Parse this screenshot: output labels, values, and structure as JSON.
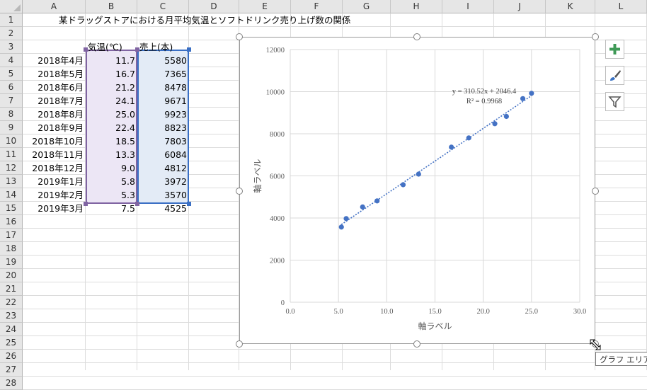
{
  "columns": [
    "A",
    "B",
    "C",
    "D",
    "E",
    "F",
    "G",
    "H",
    "I",
    "J",
    "K",
    "L"
  ],
  "rows": [
    "1",
    "2",
    "3",
    "4",
    "5",
    "6",
    "7",
    "8",
    "9",
    "10",
    "11",
    "12",
    "13",
    "14",
    "15",
    "16",
    "17",
    "18",
    "19",
    "20",
    "21",
    "22",
    "23",
    "24",
    "25",
    "26",
    "27",
    "28"
  ],
  "title": "某ドラッグストアにおける月平均気温とソフトドリンク売り上げ数の関係",
  "table": {
    "headers": [
      "気温(℃)",
      "売上(本)"
    ],
    "rows": [
      [
        "2018年4月",
        "11.7",
        "5580"
      ],
      [
        "2018年5月",
        "16.7",
        "7365"
      ],
      [
        "2018年6月",
        "21.2",
        "8478"
      ],
      [
        "2018年7月",
        "24.1",
        "9671"
      ],
      [
        "2018年8月",
        "25.0",
        "9923"
      ],
      [
        "2018年9月",
        "22.4",
        "8823"
      ],
      [
        "2018年10月",
        "18.5",
        "7803"
      ],
      [
        "2018年11月",
        "13.3",
        "6084"
      ],
      [
        "2018年12月",
        "9.0",
        "4812"
      ],
      [
        "2019年1月",
        "5.8",
        "3972"
      ],
      [
        "2019年2月",
        "5.3",
        "3570"
      ],
      [
        "2019年3月",
        "7.5",
        "4525"
      ]
    ]
  },
  "chart_data": {
    "type": "scatter",
    "title": "",
    "xlabel": "軸ラベル",
    "ylabel": "軸ラベル",
    "xlim": [
      0,
      30
    ],
    "ylim": [
      0,
      12000
    ],
    "xticks": [
      "0.0",
      "5.0",
      "10.0",
      "15.0",
      "20.0",
      "25.0",
      "30.0"
    ],
    "yticks": [
      "0",
      "2000",
      "4000",
      "6000",
      "8000",
      "10000",
      "12000"
    ],
    "x": [
      11.7,
      16.7,
      21.2,
      24.1,
      25.0,
      22.4,
      18.5,
      13.3,
      9.0,
      5.8,
      5.3,
      7.5
    ],
    "y": [
      5580,
      7365,
      8478,
      9671,
      9923,
      8823,
      7803,
      6084,
      4812,
      3972,
      3570,
      4525
    ],
    "trendline": {
      "slope": 310.52,
      "intercept": 2046.4,
      "equation": "y = 310.52x + 2046.4",
      "r2": "R² = 0.9968"
    },
    "grid": true,
    "point_color": "#4472c4"
  },
  "tooltip": "グラフ エリア",
  "side_buttons": [
    "chart-elements",
    "chart-styles",
    "chart-filters"
  ]
}
